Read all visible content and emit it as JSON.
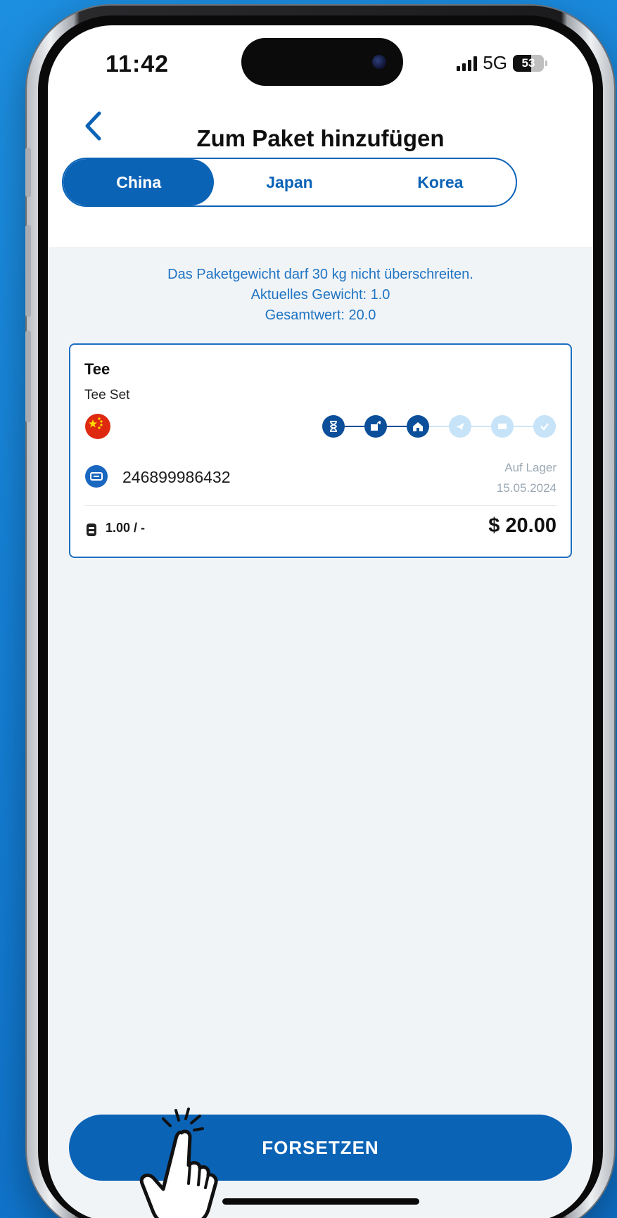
{
  "status_bar": {
    "time": "11:42",
    "network": "5G",
    "battery": "53"
  },
  "header": {
    "back_icon": "chevron-left-icon",
    "title": "Zum Paket hinzufügen"
  },
  "tabs": [
    {
      "label": "China",
      "active": true
    },
    {
      "label": "Japan",
      "active": false
    },
    {
      "label": "Korea",
      "active": false
    }
  ],
  "info": {
    "line1": "Das Paketgewicht darf 30 kg nicht überschreiten.",
    "line2": "Aktuelles Gewicht: 1.0",
    "line3": "Gesamtwert: 20.0"
  },
  "item": {
    "title": "Tee",
    "subtitle": "Tee Set",
    "origin_icon": "china-flag-icon",
    "tracking_number": "246899986432",
    "status": "Auf Lager",
    "date": "15.05.2024",
    "weight": "1.00 / -",
    "price": "$ 20.00",
    "progress_steps_completed": 3,
    "progress_steps_total": 6
  },
  "cta": {
    "label": "FORSETZEN"
  },
  "colors": {
    "primary": "#0b63b6",
    "info_text": "#1f74c3",
    "step_on": "#0b4f9a",
    "step_off": "#c6e3f8"
  }
}
